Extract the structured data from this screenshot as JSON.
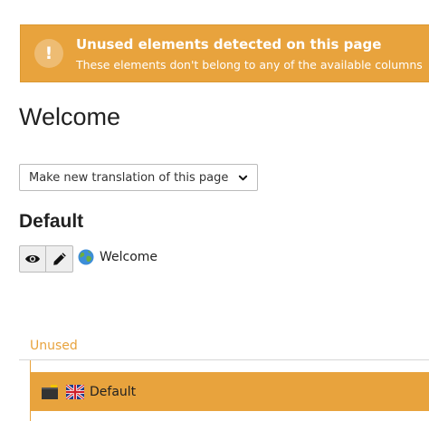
{
  "callout": {
    "icon": "exclamation-icon",
    "icon_glyph": "!",
    "title": "Unused elements detected on this page",
    "message": "These elements don't belong to any of the available columns"
  },
  "page": {
    "title": "Welcome"
  },
  "translation_select": {
    "selected": "Make new translation of this page",
    "icon": "chevron-down-icon"
  },
  "section": {
    "title": "Default",
    "buttons": [
      {
        "icon": "eye-icon"
      },
      {
        "icon": "pencil-icon"
      }
    ],
    "record": {
      "icon": "globe-icon",
      "label": "Welcome"
    }
  },
  "unused": {
    "label": "Unused",
    "item": {
      "type_icon": "content-element-icon",
      "flag_icon": "uk-flag-icon",
      "label": "Default"
    }
  },
  "colors": {
    "warning": "#e8a33d",
    "text": "#212121",
    "border": "#bbbbbb"
  }
}
